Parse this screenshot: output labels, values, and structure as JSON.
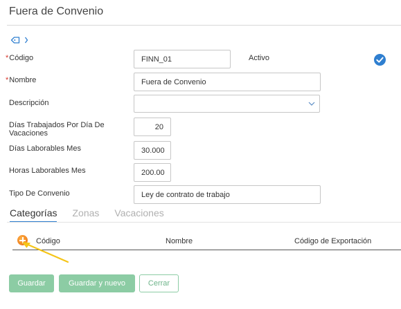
{
  "header": {
    "title": "Fuera de Convenio"
  },
  "breadcrumb": {
    "icons": [
      "tag-icon",
      "chevron-right-icon"
    ]
  },
  "form": {
    "codigo": {
      "label": "Código",
      "value": "FINN_01",
      "required": true
    },
    "activo": {
      "label": "Activo",
      "checked": true
    },
    "nombre": {
      "label": "Nombre",
      "value": "Fuera de Convenio",
      "required": true
    },
    "descripcion": {
      "label": "Descripción",
      "value": ""
    },
    "dias_trabajados": {
      "label_line1": "Días Trabajados Por Día De",
      "label_line2": "Vacaciones",
      "value": "20"
    },
    "dias_laborables": {
      "label": "Días Laborables Mes",
      "value": "30.000"
    },
    "horas_laborables": {
      "label": "Horas Laborables Mes",
      "value": "200.00"
    },
    "tipo_convenio": {
      "label": "Tipo De Convenio",
      "value": "Ley de contrato de trabajo"
    }
  },
  "tabs": [
    {
      "label": "Categorías",
      "active": true
    },
    {
      "label": "Zonas",
      "active": false
    },
    {
      "label": "Vacaciones",
      "active": false
    }
  ],
  "grid": {
    "columns": [
      "Código",
      "Nombre",
      "Código de Exportación"
    ]
  },
  "actions": {
    "save": "Guardar",
    "save_new": "Guardar y nuevo",
    "cancel": "Cerrar"
  },
  "colors": {
    "accent": "#2f7fd0",
    "button": "#8ccca4",
    "required": "#d9362b",
    "add": "#f08a1c",
    "annotation": "#f5c518"
  }
}
